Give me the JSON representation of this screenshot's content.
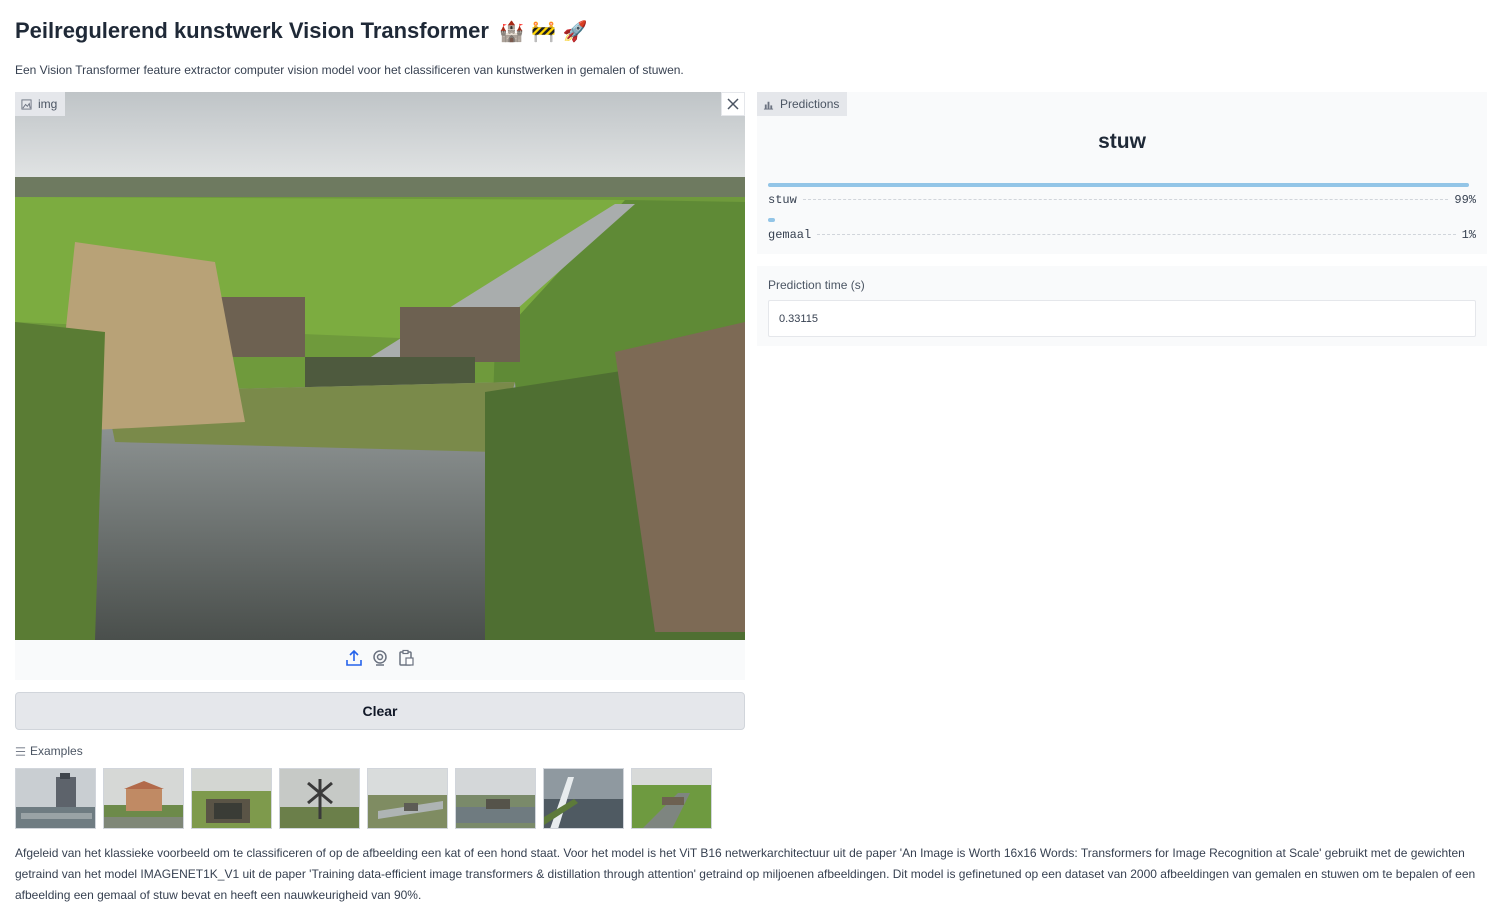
{
  "header": {
    "title": "Peilregulerend kunstwerk Vision Transformer",
    "title_emojis": "🏰 🚧 🚀",
    "description": "Een Vision Transformer feature extractor computer vision model voor het classificeren van kunstwerken in gemalen of stuwen."
  },
  "image_input": {
    "label": "img",
    "label_icon": "image-icon",
    "close_icon": "close-icon",
    "tools": [
      "upload-icon",
      "webcam-icon",
      "clipboard-icon"
    ]
  },
  "clear_button": {
    "label": "Clear"
  },
  "examples": {
    "label": "Examples",
    "label_icon": "list-icon",
    "items": [
      "example-1",
      "example-2",
      "example-3",
      "example-4",
      "example-5",
      "example-6",
      "example-7",
      "example-8"
    ]
  },
  "predictions": {
    "label": "Predictions",
    "label_icon": "bar-chart-icon",
    "top_label": "stuw",
    "confidences": [
      {
        "label": "stuw",
        "value": 0.99,
        "display": "99%"
      },
      {
        "label": "gemaal",
        "value": 0.01,
        "display": "1%"
      }
    ]
  },
  "prediction_time": {
    "label": "Prediction time (s)",
    "value": "0.33115"
  },
  "footer": {
    "text": "Afgeleid van het klassieke voorbeeld om te classificeren of op de afbeelding een kat of een hond staat. Voor het model is het ViT B16 netwerkarchitectuur uit de paper 'An Image is Worth 16x16 Words: Transformers for Image Recognition at Scale' gebruikt met de gewichten getraind van het model IMAGENET1K_V1 uit de paper 'Training data-efficient image transformers & distillation through attention' getraind op miljoenen afbeeldingen. Dit model is gefinetuned op een dataset van 2000 afbeeldingen van gemalen en stuwen om te bepalen of een afbeelding een gemaal of stuw bevat en heeft een nauwkeurigheid van 90%."
  },
  "colors": {
    "accent_bar": "#93c5e7",
    "panel_bg": "#f9fafb",
    "tag_bg": "#e5e7eb",
    "icon_blue": "#2563eb"
  }
}
